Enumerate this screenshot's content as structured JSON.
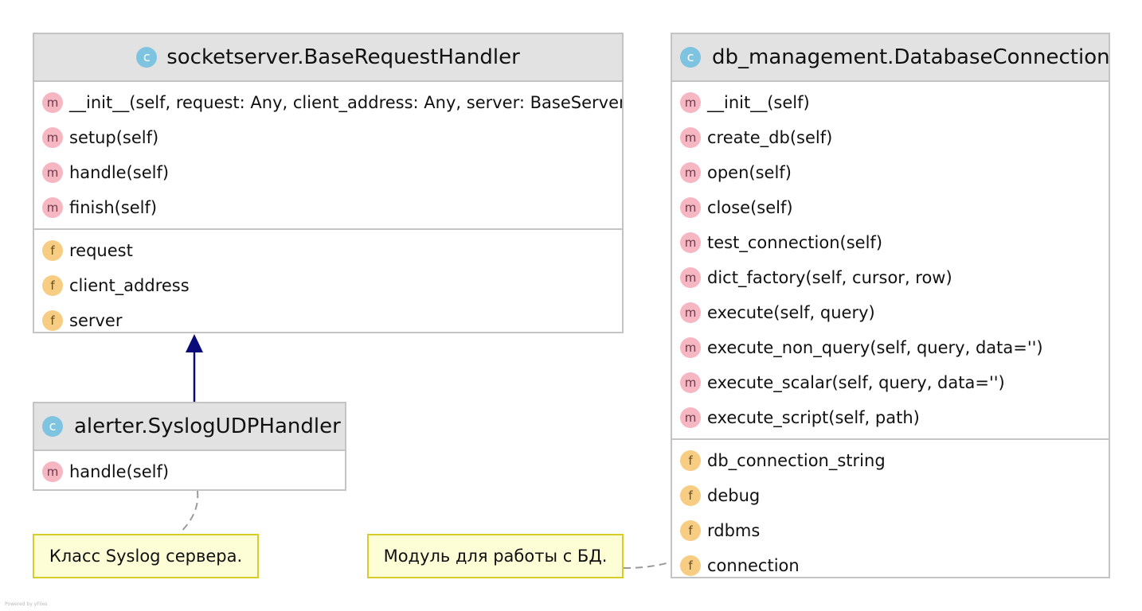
{
  "classes": {
    "base_request_handler": {
      "name": "socketserver.BaseRequestHandler",
      "methods": [
        "__init__(self, request: Any, client_address: Any, server: BaseServer",
        "setup(self)",
        "handle(self)",
        "finish(self)"
      ],
      "fields": [
        "request",
        "client_address",
        "server"
      ]
    },
    "syslog_udp_handler": {
      "name": "alerter.SyslogUDPHandler",
      "methods": [
        "handle(self)"
      ]
    },
    "database_connection": {
      "name": "db_management.DatabaseConnection",
      "methods": [
        "__init__(self)",
        "create_db(self)",
        "open(self)",
        "close(self)",
        "test_connection(self)",
        "dict_factory(self, cursor, row)",
        "execute(self, query)",
        "execute_non_query(self, query, data='')",
        "execute_scalar(self, query, data='')",
        "execute_script(self, path)"
      ],
      "fields": [
        "db_connection_string",
        "debug",
        "rdbms",
        "connection"
      ]
    }
  },
  "notes": {
    "syslog": "Класс Syslog сервера.",
    "db": "Модуль для работы с БД."
  },
  "badges": {
    "class": "c",
    "method": "m",
    "field": "f"
  },
  "footer": "Powered by yFiles",
  "colors": {
    "header_bg": "#e2e2e2",
    "border": "#c4c4c4",
    "inheritance_arrow": "#0a0a7a",
    "note_bg": "#fefed6",
    "note_border": "#d6cc2a",
    "method_badge": "#f6b6c2",
    "field_badge": "#f7cd83",
    "class_badge": "#7ec4e0"
  }
}
